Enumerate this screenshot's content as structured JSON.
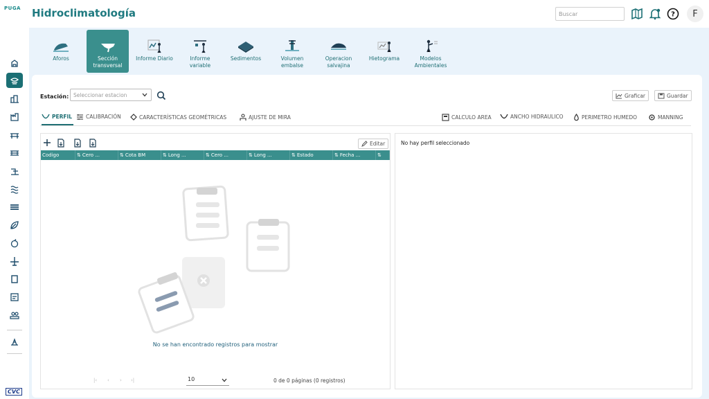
{
  "header": {
    "logo": "PUGA",
    "title": "Hidroclimatología",
    "search_placeholder": "Buscar",
    "avatar_initial": "F"
  },
  "ribbon": [
    {
      "label": "Aforos",
      "icon": "aforos-icon"
    },
    {
      "label": "Sección transversal",
      "icon": "seccion-icon",
      "active": true
    },
    {
      "label": "Informe Diario",
      "icon": "informe-diario-icon"
    },
    {
      "label": "Informe variable",
      "icon": "informe-variable-icon"
    },
    {
      "label": "Sedimentos",
      "icon": "sedimentos-icon"
    },
    {
      "label": "Volumen embalse",
      "icon": "volumen-icon"
    },
    {
      "label": "Operacion salvajina",
      "icon": "operacion-icon"
    },
    {
      "label": "Hietograma",
      "icon": "hietograma-icon"
    },
    {
      "label": "Modelos Ambientales",
      "icon": "modelos-icon"
    }
  ],
  "toolbar": {
    "station_label": "Estación:",
    "station_placeholder": "Seleccionar estacion",
    "graficar": "Graficar",
    "guardar": "Guardar"
  },
  "tabs": {
    "perfil": "PERFIL",
    "calibracion": "CALIBRACIÓN",
    "caracteristicas": "CARACTERÍSTICAS GEOMÉTRICAS",
    "ajuste": "AJUSTE DE MIRA",
    "calculo_area": "CALCULO AREA",
    "ancho": "ANCHO HIDRAULICO",
    "perimetro": "PERIMETRO HUMEDO",
    "manning": "MANNING"
  },
  "grid": {
    "edit_label": "Editar",
    "columns": [
      "Codigo",
      "Cero ...",
      "Cota BM",
      "Long ...",
      "Cero ...",
      "Long ...",
      "Estado",
      "Fecha ...",
      ""
    ],
    "empty_message": "No se han encontrado registros para mostrar",
    "page_size": "10",
    "page_info": "0 de 0 páginas (0 registros)"
  },
  "right_panel": {
    "message": "No hay perfil seleccionado"
  },
  "colors": {
    "accent": "#3a8f8d",
    "title": "#1f7a80",
    "background": "#eaf3fb"
  }
}
